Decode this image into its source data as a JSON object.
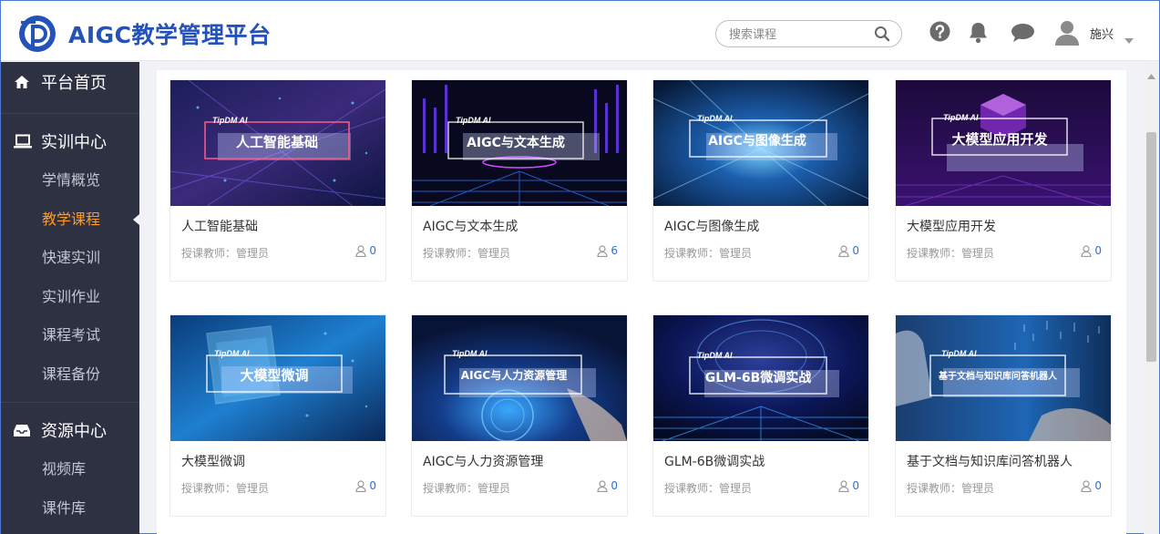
{
  "header": {
    "app_title": "AIGC教学管理平台",
    "search_placeholder": "搜索课程",
    "user_name": "施兴"
  },
  "sidebar": {
    "groups": [
      {
        "label": "平台首页",
        "icon": "home-icon",
        "items": []
      },
      {
        "label": "实训中心",
        "icon": "laptop-icon",
        "items": [
          "学情概览",
          "教学课程",
          "快速实训",
          "实训作业",
          "课程考试",
          "课程备份"
        ]
      },
      {
        "label": "资源中心",
        "icon": "inbox-icon",
        "items": [
          "视频库",
          "课件库"
        ]
      }
    ],
    "active_item": "教学课程"
  },
  "courses": [
    {
      "title": "人工智能基础",
      "banner_brand": "TipDM AI",
      "banner_text": "人工智能基础",
      "teacher": "授课教师：管理员",
      "students": "0"
    },
    {
      "title": "AIGC与文本生成",
      "banner_brand": "TipDM AI",
      "banner_text": "AIGC与文本生成",
      "teacher": "授课教师：管理员",
      "students": "6"
    },
    {
      "title": "AIGC与图像生成",
      "banner_brand": "TipDM AI",
      "banner_text": "AIGC与图像生成",
      "teacher": "授课教师：管理员",
      "students": "0"
    },
    {
      "title": "大模型应用开发",
      "banner_brand": "TipDM AI",
      "banner_text": "大模型应用开发",
      "teacher": "授课教师：管理员",
      "students": "0"
    },
    {
      "title": "大模型微调",
      "banner_brand": "TipDM AI",
      "banner_text": "大模型微调",
      "teacher": "授课教师：管理员",
      "students": "0"
    },
    {
      "title": "AIGC与人力资源管理",
      "banner_brand": "TipDM AI",
      "banner_text": "AIGC与人力资源管理",
      "teacher": "授课教师：管理员",
      "students": "0"
    },
    {
      "title": "GLM-6B微调实战",
      "banner_brand": "TipDM AI",
      "banner_text": "GLM-6B微调实战",
      "teacher": "授课教师：管理员",
      "students": "0"
    },
    {
      "title": "基于文档与知识库问答机器人",
      "banner_brand": "TipDM AI",
      "banner_text": "基于文档与知识库问答机器人",
      "teacher": "授课教师：管理员",
      "students": "0"
    }
  ],
  "colors": {
    "brand_blue": "#2352b8",
    "sidebar_bg": "#2d3142",
    "active_orange": "#ff9a23",
    "count_blue": "#2f6fd6"
  }
}
